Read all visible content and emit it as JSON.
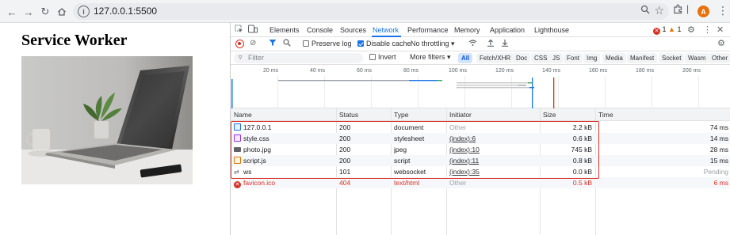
{
  "browser": {
    "url": "127.0.0.1:5500",
    "avatar_letter": "A"
  },
  "page": {
    "heading": "Service Worker",
    "image_alt": "laptop-photo"
  },
  "devtools": {
    "tabs": [
      "Elements",
      "Console",
      "Sources",
      "Network",
      "Performance",
      "Memory",
      "Application",
      "Lighthouse"
    ],
    "active_tab": "Network",
    "errors_count": "1",
    "warnings_count": "1",
    "toolbar": {
      "preserve_log": "Preserve log",
      "disable_cache": "Disable cache",
      "throttling": "No throttling"
    },
    "filter": {
      "placeholder": "Filter",
      "invert": "Invert",
      "more_filters": "More filters",
      "types": [
        "All",
        "Fetch/XHR",
        "Doc",
        "CSS",
        "JS",
        "Font",
        "Img",
        "Media",
        "Manifest",
        "Socket",
        "Wasm",
        "Other"
      ]
    },
    "timeline_ticks": [
      "20 ms",
      "40 ms",
      "60 ms",
      "80 ms",
      "100 ms",
      "120 ms",
      "140 ms",
      "160 ms",
      "180 ms",
      "200 ms"
    ],
    "columns": {
      "name": "Name",
      "status": "Status",
      "type": "Type",
      "initiator": "Initiator",
      "size": "Size",
      "time": "Time"
    },
    "requests": [
      {
        "name": "127.0.0.1",
        "status": "200",
        "type": "document",
        "initiator": "Other",
        "size": "2.2 kB",
        "time": "74 ms",
        "icon": "document-icon"
      },
      {
        "name": "style.css",
        "status": "200",
        "type": "stylesheet",
        "initiator": "(index):6",
        "size": "0.6 kB",
        "time": "14 ms",
        "icon": "stylesheet-icon"
      },
      {
        "name": "photo.jpg",
        "status": "200",
        "type": "jpeg",
        "initiator": "(index):10",
        "size": "745 kB",
        "time": "28 ms",
        "icon": "image-icon"
      },
      {
        "name": "script.js",
        "status": "200",
        "type": "script",
        "initiator": "(index):11",
        "size": "0.8 kB",
        "time": "15 ms",
        "icon": "script-icon"
      },
      {
        "name": "ws",
        "status": "101",
        "type": "websocket",
        "initiator": "(index):35",
        "size": "0.0 kB",
        "time": "Pending",
        "icon": "websocket-icon"
      },
      {
        "name": "favicon.ico",
        "status": "404",
        "type": "text/html",
        "initiator": "Other",
        "size": "0.5 kB",
        "time": "6 ms",
        "icon": "error-icon"
      }
    ]
  },
  "colors": {
    "accent": "#1a73e8",
    "error": "#d93025",
    "highlight_box": "#d93025"
  }
}
